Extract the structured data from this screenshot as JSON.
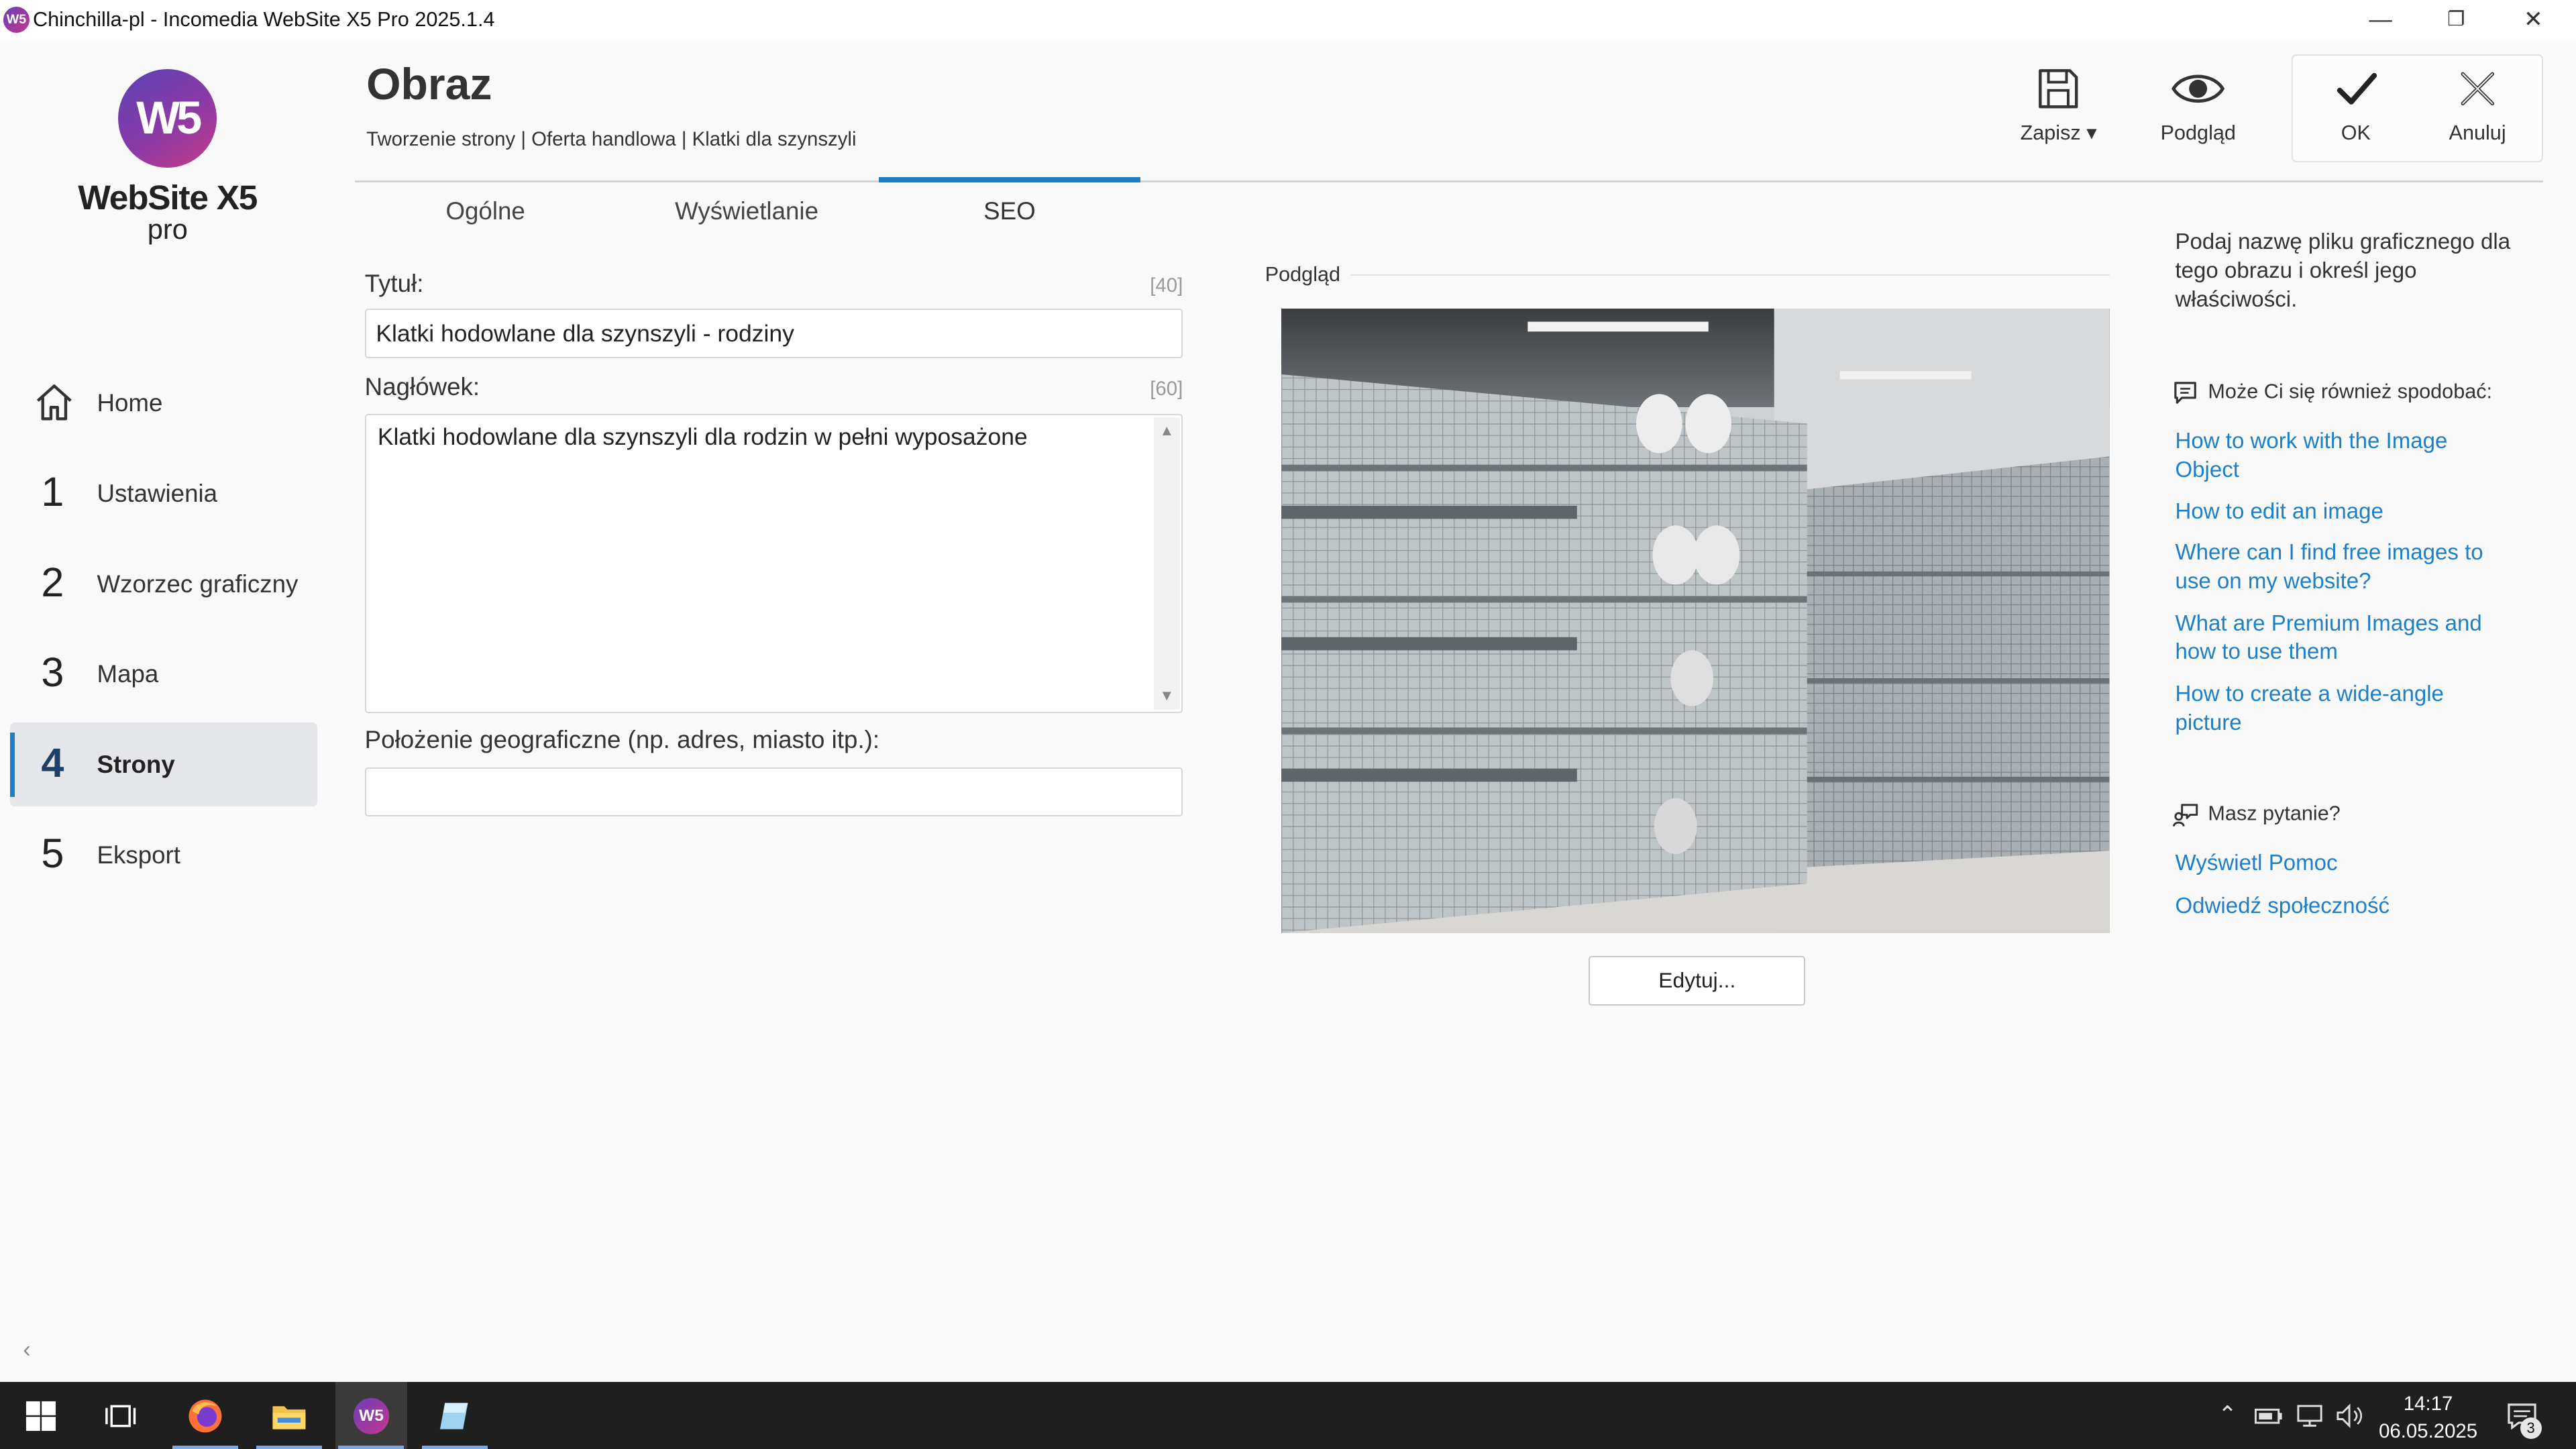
{
  "window": {
    "title": "Chinchilla-pl - Incomedia WebSite X5 Pro 2025.1.4",
    "app_icon": "W5",
    "controls": {
      "minimize": "—",
      "maximize": "❐",
      "close": "✕"
    }
  },
  "logo": {
    "mark": "W5",
    "brand": "WebSite X5",
    "edition": "pro"
  },
  "sidebar": {
    "items": [
      {
        "num": "",
        "label": "Home",
        "icon": "home-icon"
      },
      {
        "num": "1",
        "label": "Ustawienia"
      },
      {
        "num": "2",
        "label": "Wzorzec graficzny"
      },
      {
        "num": "3",
        "label": "Mapa"
      },
      {
        "num": "4",
        "label": "Strony",
        "active": true
      },
      {
        "num": "5",
        "label": "Eksport"
      }
    ],
    "collapse": "‹"
  },
  "header": {
    "title": "Obraz",
    "breadcrumb": "Tworzenie strony | Oferta handlowa | Klatki dla szynszyli"
  },
  "toolbar": {
    "save_label": "Zapisz ▾",
    "preview_label": "Podgląd",
    "ok_label": "OK",
    "cancel_label": "Anuluj"
  },
  "tabs": [
    {
      "label": "Ogólne"
    },
    {
      "label": "Wyświetlanie"
    },
    {
      "label": "SEO",
      "active": true
    }
  ],
  "form": {
    "title_label": "Tytuł:",
    "title_count": "[40]",
    "title_value": "Klatki hodowlane dla szynszyli - rodziny",
    "header_label": "Nagłówek:",
    "header_count": "[60]",
    "header_value": "Klatki hodowlane dla szynszyli dla rodzin w pełni wyposażone",
    "geo_label": "Położenie geograficzne (np. adres, miasto itp.):",
    "geo_value": ""
  },
  "preview": {
    "label": "Podgląd",
    "edit_button": "Edytuj..."
  },
  "help": {
    "intro": "Podaj nazwę pliku graficznego dla tego obrazu i określ jego właściwości.",
    "related_heading": "Może Ci się również spodobać:",
    "links": [
      "How to work with the Image Object",
      "How to edit an image",
      "Where can I find free images to use on my website?",
      "What are Premium Images and how to use them",
      "How to create a wide-angle picture"
    ],
    "questions_heading": "Masz pytanie?",
    "support_links": [
      "Wyświetl Pomoc",
      "Odwiedź społeczność"
    ]
  },
  "taskbar": {
    "time": "14:17",
    "date": "06.05.2025",
    "notifications": "3",
    "apps": [
      "windows-start-icon",
      "task-view-icon",
      "firefox-icon",
      "file-explorer-icon",
      "website-x5-icon",
      "notes-app-icon"
    ],
    "x5_icon_text": "W5"
  },
  "colors": {
    "accent": "#1e7fc9",
    "link": "#1e7fc9",
    "taskbar": "#1f1f1f",
    "active_nav": "#e4e6ea"
  }
}
